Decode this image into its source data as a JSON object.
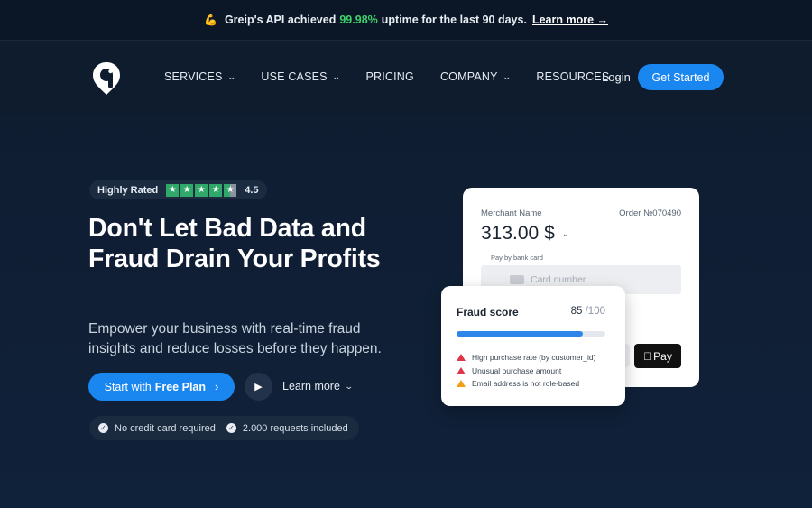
{
  "announcement": {
    "icon": "arm-flex-icon",
    "prefix": "Greip's API achieved",
    "uptime": "99.98%",
    "suffix": "uptime for the last 90 days.",
    "link": "Learn more →"
  },
  "nav": {
    "items": [
      {
        "label": "SERVICES",
        "dropdown": true
      },
      {
        "label": "USE CASES",
        "dropdown": true
      },
      {
        "label": "PRICING",
        "dropdown": false
      },
      {
        "label": "COMPANY",
        "dropdown": true
      },
      {
        "label": "RESOURCES",
        "dropdown": true
      }
    ],
    "login": "Login",
    "cta": "Get Started"
  },
  "hero": {
    "rating_label": "Highly Rated",
    "rating_value": "4.5",
    "rating_stars": 4.5,
    "headline": "Don't Let Bad Data and Fraud Drain Your Profits",
    "subheadline": "Empower your business with real-time fraud insights and reduce losses before they happen.",
    "start_prefix": "Start with",
    "start_bold": "Free Plan",
    "learn_more": "Learn more",
    "badges": [
      "No credit card required",
      "2.000 requests included"
    ]
  },
  "payment": {
    "merchant": "Merchant Name",
    "order": "Order №070490",
    "amount": "313.00 $",
    "pay_label": "Pay by bank card",
    "card_placeholder": "Card number",
    "apple_pay": "Pay"
  },
  "fraud": {
    "title": "Fraud score",
    "score": "85",
    "max": "/100",
    "score_fraction": 0.85,
    "reasons": [
      {
        "text": "High purchase rate (by customer_id)",
        "level": "high"
      },
      {
        "text": "Unusual purchase amount",
        "level": "high"
      },
      {
        "text": "Email address is not role-based",
        "level": "medium"
      }
    ]
  },
  "colors": {
    "background": "#0e1b2c",
    "accent": "#1a86f0",
    "uptime_green": "#3fd26a",
    "star_green": "#2fa86a",
    "alert_red": "#e0364a",
    "alert_orange": "#f29d1a"
  }
}
